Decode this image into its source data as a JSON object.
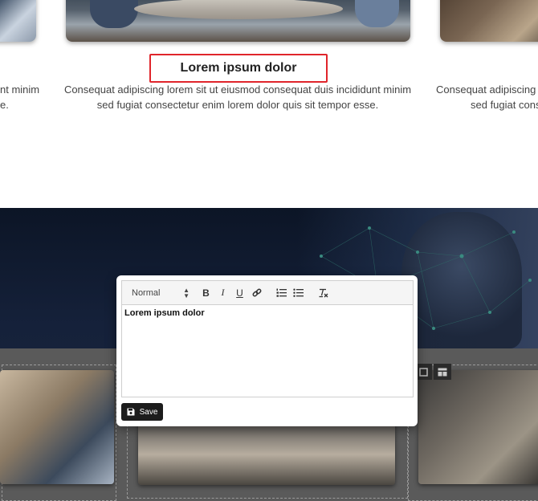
{
  "cards": {
    "center": {
      "title": "Lorem ipsum dolor",
      "text": "Consequat adipiscing lorem sit ut eiusmod consequat duis incididunt minim sed fugiat consectetur enim lorem dolor quis sit tempor esse."
    },
    "left": {
      "text_line1": "nt minim",
      "text_line2": "e."
    },
    "right": {
      "text_line1": "Consequat adipiscing",
      "text_line2": "sed fugiat cons"
    }
  },
  "editor": {
    "format_select": "Normal",
    "toolbar_buttons": [
      "B",
      "I",
      "U",
      "link-icon",
      "ordered-list-icon",
      "bullet-list-icon",
      "clear-format-icon"
    ],
    "content": "Lorem ipsum dolor",
    "save_label": "Save"
  },
  "colors": {
    "highlight_border": "#e0252b",
    "save_button": "#1c1c1c",
    "banner": "#15213a"
  }
}
